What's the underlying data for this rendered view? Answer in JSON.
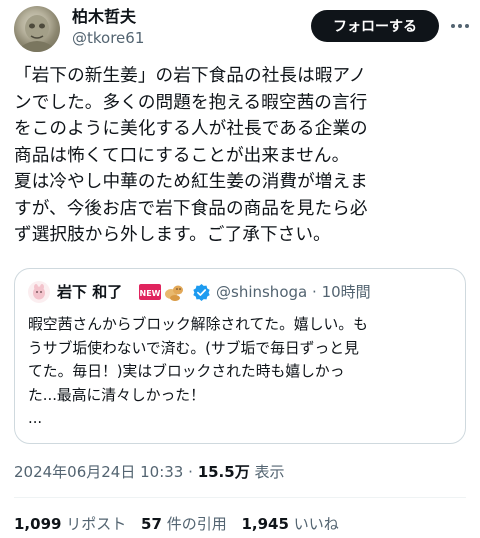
{
  "author": {
    "name": "柏木哲夫",
    "handle": "@tkore61",
    "follow_label": "フォローする"
  },
  "tweet": {
    "lines": [
      "「岩下の新生姜」の岩下食品の社長は暇アノ",
      "ンでした。多くの問題を抱える暇空茜の言行",
      "をこのように美化する人が社長である企業の",
      "商品は怖くて口にすることが出来ません。",
      "夏は冷やし中華のため紅生姜の消費が増えま",
      "すが、今後お店で岩下食品の商品を見たら必",
      "ず選択肢から外します。ご了承下さい。"
    ]
  },
  "quote": {
    "name": "岩下 和了",
    "badge": "NEW",
    "handle": "@shinshoga",
    "separator": "·",
    "time": "10時間",
    "lines": [
      "暇空茜さんからブロック解除されてた。嬉しい。も",
      "うサブ垢使わないで済む。(サブ垢で毎日ずっと見",
      "てた。毎日！)実はブロックされた時も嬉しかっ",
      "た...最高に清々しかった！",
      "..."
    ]
  },
  "meta": {
    "datetime": "2024年06月24日 10:33",
    "dot": "·",
    "views": "15.5万",
    "views_label": "表示"
  },
  "stats": {
    "reposts": "1,099",
    "reposts_label": "リポスト",
    "quotes": "57",
    "quotes_label": "件の引用",
    "likes": "1,945",
    "likes_label": "いいね"
  },
  "icons": {
    "more": "more-horizontal-icon",
    "verified": "verified-badge-icon",
    "ginger": "ginger-mascot-icon"
  },
  "colors": {
    "verified": "#1d9bf0",
    "badge_red": "#e0245e",
    "follow_bg": "#0f1419",
    "secondary_text": "#536471"
  }
}
